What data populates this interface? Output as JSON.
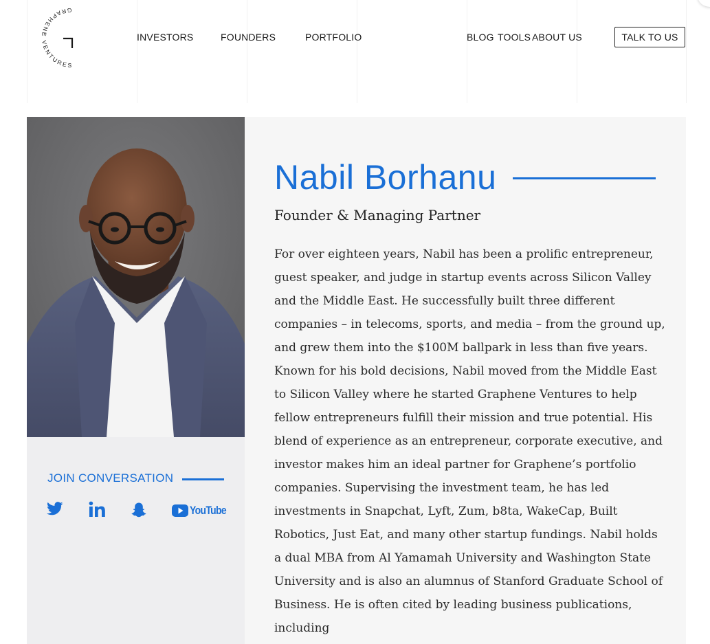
{
  "header": {
    "logo": {
      "text": "GRAPHENE VENTURES",
      "icon": "graphene-ventures-logo"
    },
    "nav_left": [
      "INVESTORS",
      "FOUNDERS",
      "PORTFOLIO"
    ],
    "nav_right": [
      "BLOG",
      "TOOLS",
      "ABOUT US"
    ],
    "cta_label": "TALK TO US"
  },
  "profile": {
    "name": "Nabil Borhanu",
    "title": "Founder & Managing Partner",
    "bio": "For over eighteen years, Nabil has been a prolific entrepreneur, guest speaker, and judge in startup events across Silicon Valley and the Middle East. He successfully built three different companies – in telecoms, sports, and media – from the ground up, and grew them into the $100M ballpark in less than five years. Known for his bold decisions, Nabil moved from the Middle East to Silicon Valley where he started Graphene Ventures to help fellow entrepreneurs fulfill their mission and true potential. His blend of experience as an entrepreneur, corporate executive, and investor makes him an ideal partner for Graphene’s portfolio companies. Supervising the investment team, he has led investments in Snapchat, Lyft, Zum, b8ta, WakeCap, Built Robotics, Just Eat, and many other startup fundings. Nabil holds a dual MBA from Al Yamamah University and Washington State University and is also an alumnus of Stanford Graduate School of Business. He is often cited by leading business publications, including",
    "photo_icon": "portrait-photo"
  },
  "social": {
    "heading": "JOIN CONVERSATION",
    "links": [
      {
        "icon": "twitter-icon"
      },
      {
        "icon": "linkedin-icon"
      },
      {
        "icon": "snapchat-icon"
      },
      {
        "icon": "youtube-icon",
        "label": "YouTube"
      }
    ]
  },
  "colors": {
    "accent": "#1a6fd6",
    "left_panel_bg": "#eeeef0",
    "right_panel_bg": "#f6f6f6",
    "text": "#222222"
  }
}
